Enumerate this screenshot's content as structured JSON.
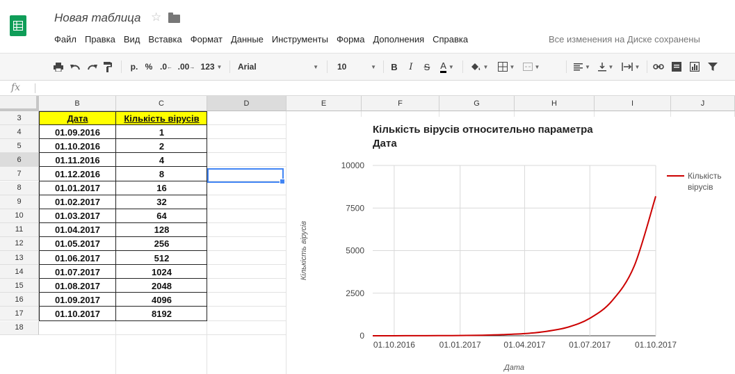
{
  "header": {
    "doc_title": "Новая таблица",
    "save_status": "Все изменения на Диске сохранены",
    "menu": [
      "Файл",
      "Правка",
      "Вид",
      "Вставка",
      "Формат",
      "Данные",
      "Инструменты",
      "Форма",
      "Дополнения",
      "Справка"
    ]
  },
  "toolbar": {
    "currency": "р.",
    "percent": "%",
    "dec_decrease": ".0",
    "dec_increase": ".00",
    "more_formats": "123",
    "font_name": "Arial",
    "font_size": "10",
    "bold": "B",
    "italic": "I",
    "strike": "S",
    "text_color": "A"
  },
  "formula_bar": {
    "fx": "fx",
    "value": ""
  },
  "grid": {
    "columns": [
      "B",
      "C",
      "D",
      "E",
      "F",
      "G",
      "H",
      "I",
      "J"
    ],
    "rows": [
      "3",
      "4",
      "5",
      "6",
      "7",
      "8",
      "9",
      "10",
      "11",
      "12",
      "13",
      "14",
      "15",
      "16",
      "17",
      "18"
    ],
    "table_header": [
      "Дата",
      "Кількість вірусів"
    ],
    "table_rows": [
      [
        "01.09.2016",
        "1"
      ],
      [
        "01.10.2016",
        "2"
      ],
      [
        "01.11.2016",
        "4"
      ],
      [
        "01.12.2016",
        "8"
      ],
      [
        "01.01.2017",
        "16"
      ],
      [
        "01.02.2017",
        "32"
      ],
      [
        "01.03.2017",
        "64"
      ],
      [
        "01.04.2017",
        "128"
      ],
      [
        "01.05.2017",
        "256"
      ],
      [
        "01.06.2017",
        "512"
      ],
      [
        "01.07.2017",
        "1024"
      ],
      [
        "01.08.2017",
        "2048"
      ],
      [
        "01.09.2017",
        "4096"
      ],
      [
        "01.10.2017",
        "8192"
      ]
    ],
    "colors": {
      "header_fill": "#ffff00",
      "selection": "#4285f4"
    }
  },
  "chart_data": {
    "type": "line",
    "title": "Кількість вірусів относительно параметра Дата",
    "title_lines": [
      "Кількість вірусів относительно параметра",
      "Дата"
    ],
    "xlabel": "Дата",
    "ylabel": "Кількість вірусів",
    "x": [
      "01.09.2016",
      "01.10.2016",
      "01.11.2016",
      "01.12.2016",
      "01.01.2017",
      "01.02.2017",
      "01.03.2017",
      "01.04.2017",
      "01.05.2017",
      "01.06.2017",
      "01.07.2017",
      "01.08.2017",
      "01.09.2017",
      "01.10.2017"
    ],
    "series": [
      {
        "name": "Кількість вірусів",
        "name_lines": [
          "Кількість",
          "вірусів"
        ],
        "color": "#cc0000",
        "values": [
          1,
          2,
          4,
          8,
          16,
          32,
          64,
          128,
          256,
          512,
          1024,
          2048,
          4096,
          8192
        ]
      }
    ],
    "x_ticks": [
      "01.10.2016",
      "01.01.2017",
      "01.04.2017",
      "01.07.2017",
      "01.10.2017"
    ],
    "y_ticks": [
      0,
      2500,
      5000,
      7500,
      10000
    ],
    "ylim": [
      0,
      10000
    ],
    "xlim": [
      "01.09.2016",
      "01.10.2017"
    ],
    "grid": true,
    "legend_position": "right"
  }
}
